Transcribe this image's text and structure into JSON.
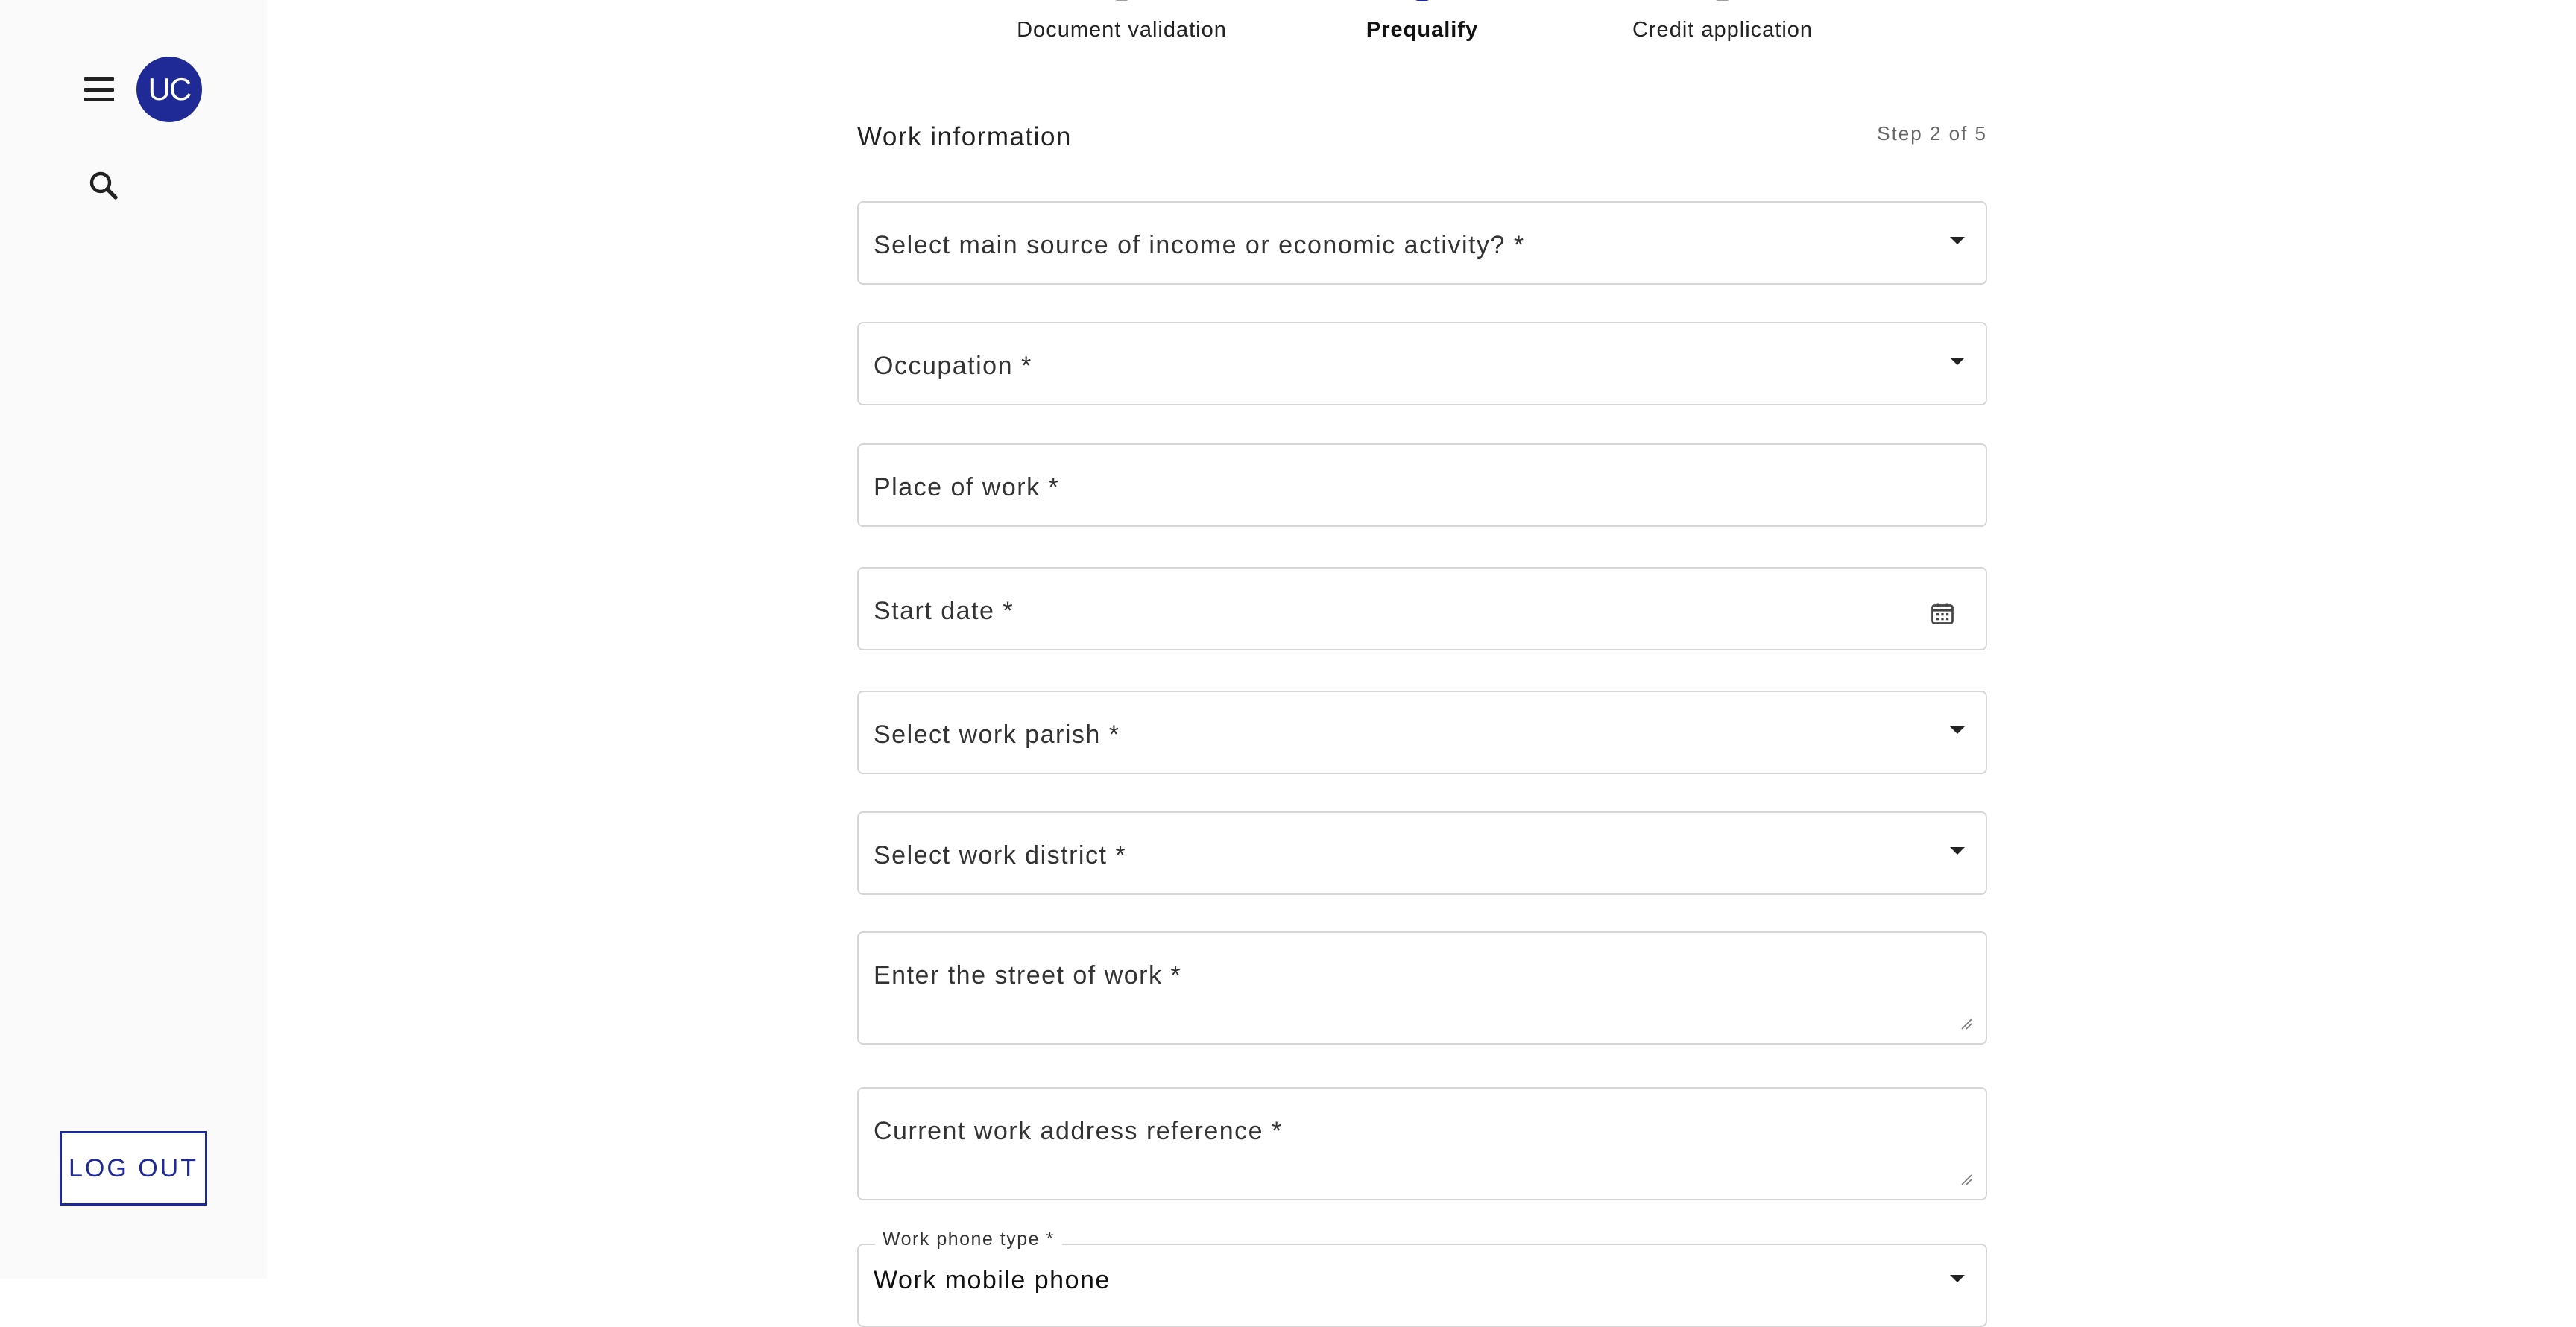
{
  "sidebar": {
    "avatar_initials": "UC",
    "menu_icon": "hamburger-menu-icon",
    "search_icon": "search-icon",
    "logout_label": "LOG OUT",
    "accent_color": "#1f2a96"
  },
  "stepper": {
    "steps": [
      {
        "label": "Document validation",
        "active": false
      },
      {
        "label": "Prequalify",
        "active": true
      },
      {
        "label": "Credit application",
        "active": false
      }
    ]
  },
  "form": {
    "title": "Work information",
    "step_indicator": "Step 2 of 5",
    "fields": {
      "income_source": {
        "label": "Select main source of income or economic activity? *",
        "type": "select"
      },
      "occupation": {
        "label": "Occupation *",
        "type": "select"
      },
      "place_of_work": {
        "label": "Place of work *",
        "type": "text"
      },
      "start_date": {
        "label": "Start date *",
        "type": "date"
      },
      "work_parish": {
        "label": "Select work parish *",
        "type": "select"
      },
      "work_district": {
        "label": "Select work district *",
        "type": "select"
      },
      "work_street": {
        "label": "Enter the street of work *",
        "type": "textarea"
      },
      "address_reference": {
        "label": "Current work address reference *",
        "type": "textarea"
      },
      "work_phone_type": {
        "label": "Work phone type *",
        "value": "Work mobile phone",
        "type": "select"
      }
    }
  }
}
